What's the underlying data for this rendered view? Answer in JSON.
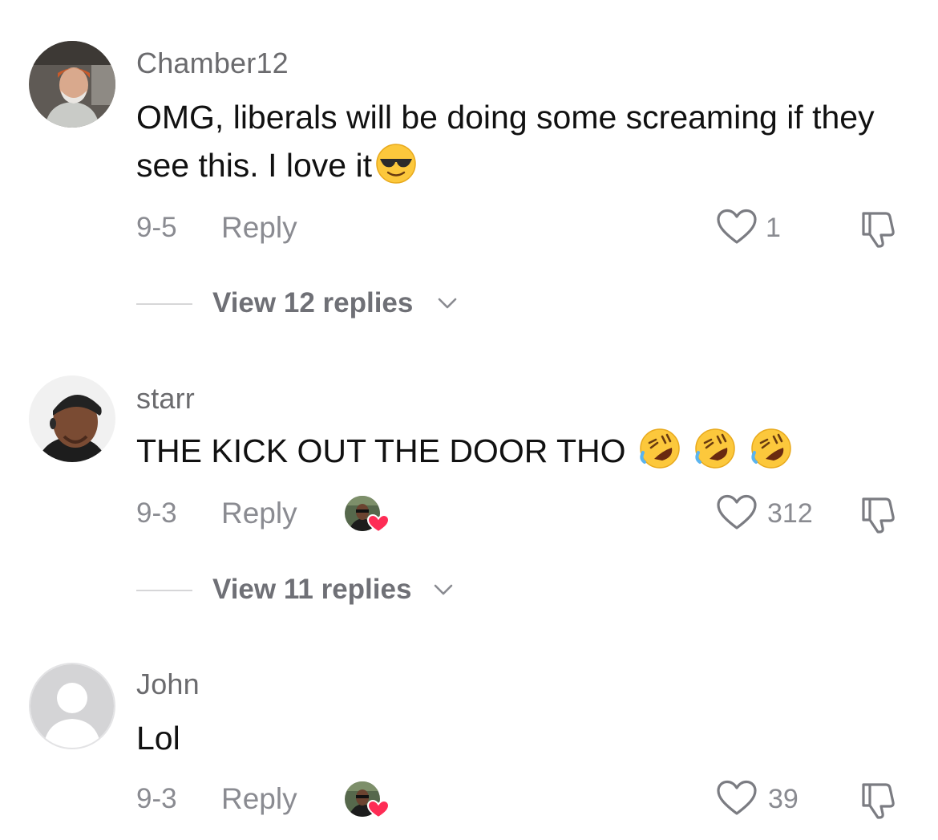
{
  "comments": [
    {
      "username": "Chamber12",
      "text": "OMG, liberals will be doing some screaming if they see this. I love it",
      "emoji": [
        "smiling-face-with-sunglasses"
      ],
      "date": "9-5",
      "reply_label": "Reply",
      "like_count": "1",
      "liked_by_creator": false,
      "view_replies_label": "View 12 replies"
    },
    {
      "username": "starr",
      "text": "THE KICK OUT THE DOOR THO",
      "emoji": [
        "rolling-on-floor-laughing",
        "rolling-on-floor-laughing",
        "rolling-on-floor-laughing"
      ],
      "date": "9-3",
      "reply_label": "Reply",
      "like_count": "312",
      "liked_by_creator": true,
      "view_replies_label": "View 11 replies"
    },
    {
      "username": "John",
      "text": "Lol",
      "emoji": [],
      "date": "9-3",
      "reply_label": "Reply",
      "like_count": "39",
      "liked_by_creator": true
    }
  ],
  "icons": {
    "like": "heart-outline-icon",
    "dislike": "thumbs-down-outline-icon",
    "expand": "chevron-down-icon",
    "creator_like_badge": "creator-liked-heart-icon"
  },
  "colors": {
    "meta_text": "#8a8b91",
    "username": "#6b6b6e",
    "creator_heart": "#fe2c55"
  }
}
